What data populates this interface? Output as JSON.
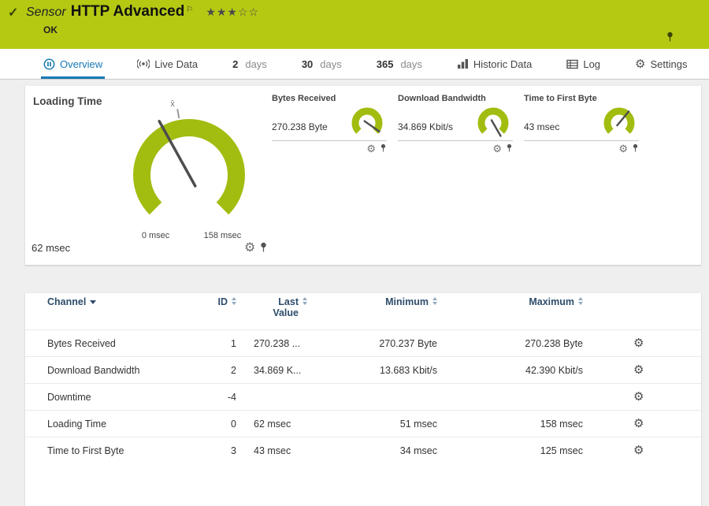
{
  "header": {
    "kind": "Sensor",
    "title": "HTTP Advanced",
    "status": "OK",
    "stars": "★★★☆☆"
  },
  "tabs": {
    "overview": "Overview",
    "live_data": "Live Data",
    "days2_num": "2",
    "days2_unit": "days",
    "days30_num": "30",
    "days30_unit": "days",
    "days365_num": "365",
    "days365_unit": "days",
    "historic": "Historic Data",
    "log": "Log",
    "settings": "Settings"
  },
  "gauge": {
    "title": "Loading Time",
    "value": "62 msec",
    "min_label": "0 msec",
    "max_label": "158 msec",
    "mean_symbol": "x̄"
  },
  "minis": [
    {
      "label": "Bytes Received",
      "value": "270.238 Byte"
    },
    {
      "label": "Download Bandwidth",
      "value": "34.869 Kbit/s"
    },
    {
      "label": "Time to First Byte",
      "value": "43 msec"
    }
  ],
  "table": {
    "headers": {
      "channel": "Channel",
      "id": "ID",
      "last_value": "Last Value",
      "minimum": "Minimum",
      "maximum": "Maximum"
    },
    "rows": [
      {
        "channel": "Bytes Received",
        "id": "1",
        "last": "270.238 ...",
        "min": "270.237 Byte",
        "max": "270.238 Byte"
      },
      {
        "channel": "Download Bandwidth",
        "id": "2",
        "last": "34.869 K...",
        "min": "13.683 Kbit/s",
        "max": "42.390 Kbit/s"
      },
      {
        "channel": "Downtime",
        "id": "-4",
        "last": "",
        "min": "",
        "max": ""
      },
      {
        "channel": "Loading Time",
        "id": "0",
        "last": "62 msec",
        "min": "51 msec",
        "max": "158 msec"
      },
      {
        "channel": "Time to First Byte",
        "id": "3",
        "last": "43 msec",
        "min": "34 msec",
        "max": "125 msec"
      }
    ]
  },
  "colors": {
    "header_green": "#b5c913",
    "gauge_green": "#a3bc10",
    "active_tab_blue": "#1779b5",
    "table_header_blue": "#2e4d6b"
  }
}
